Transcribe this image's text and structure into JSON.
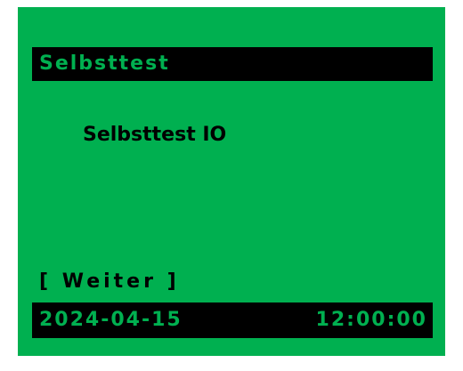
{
  "screen": {
    "title": "Selbsttest",
    "message": "Selbsttest IO",
    "softkey_label": "[ Weiter ]",
    "status": {
      "date": "2024-04-15",
      "time": "12:00:00"
    }
  },
  "colors": {
    "screen_bg": "#00b050",
    "bar_bg": "#000000",
    "bar_text": "#00b050",
    "body_text": "#000000",
    "outer_bg": "#ffffff"
  }
}
